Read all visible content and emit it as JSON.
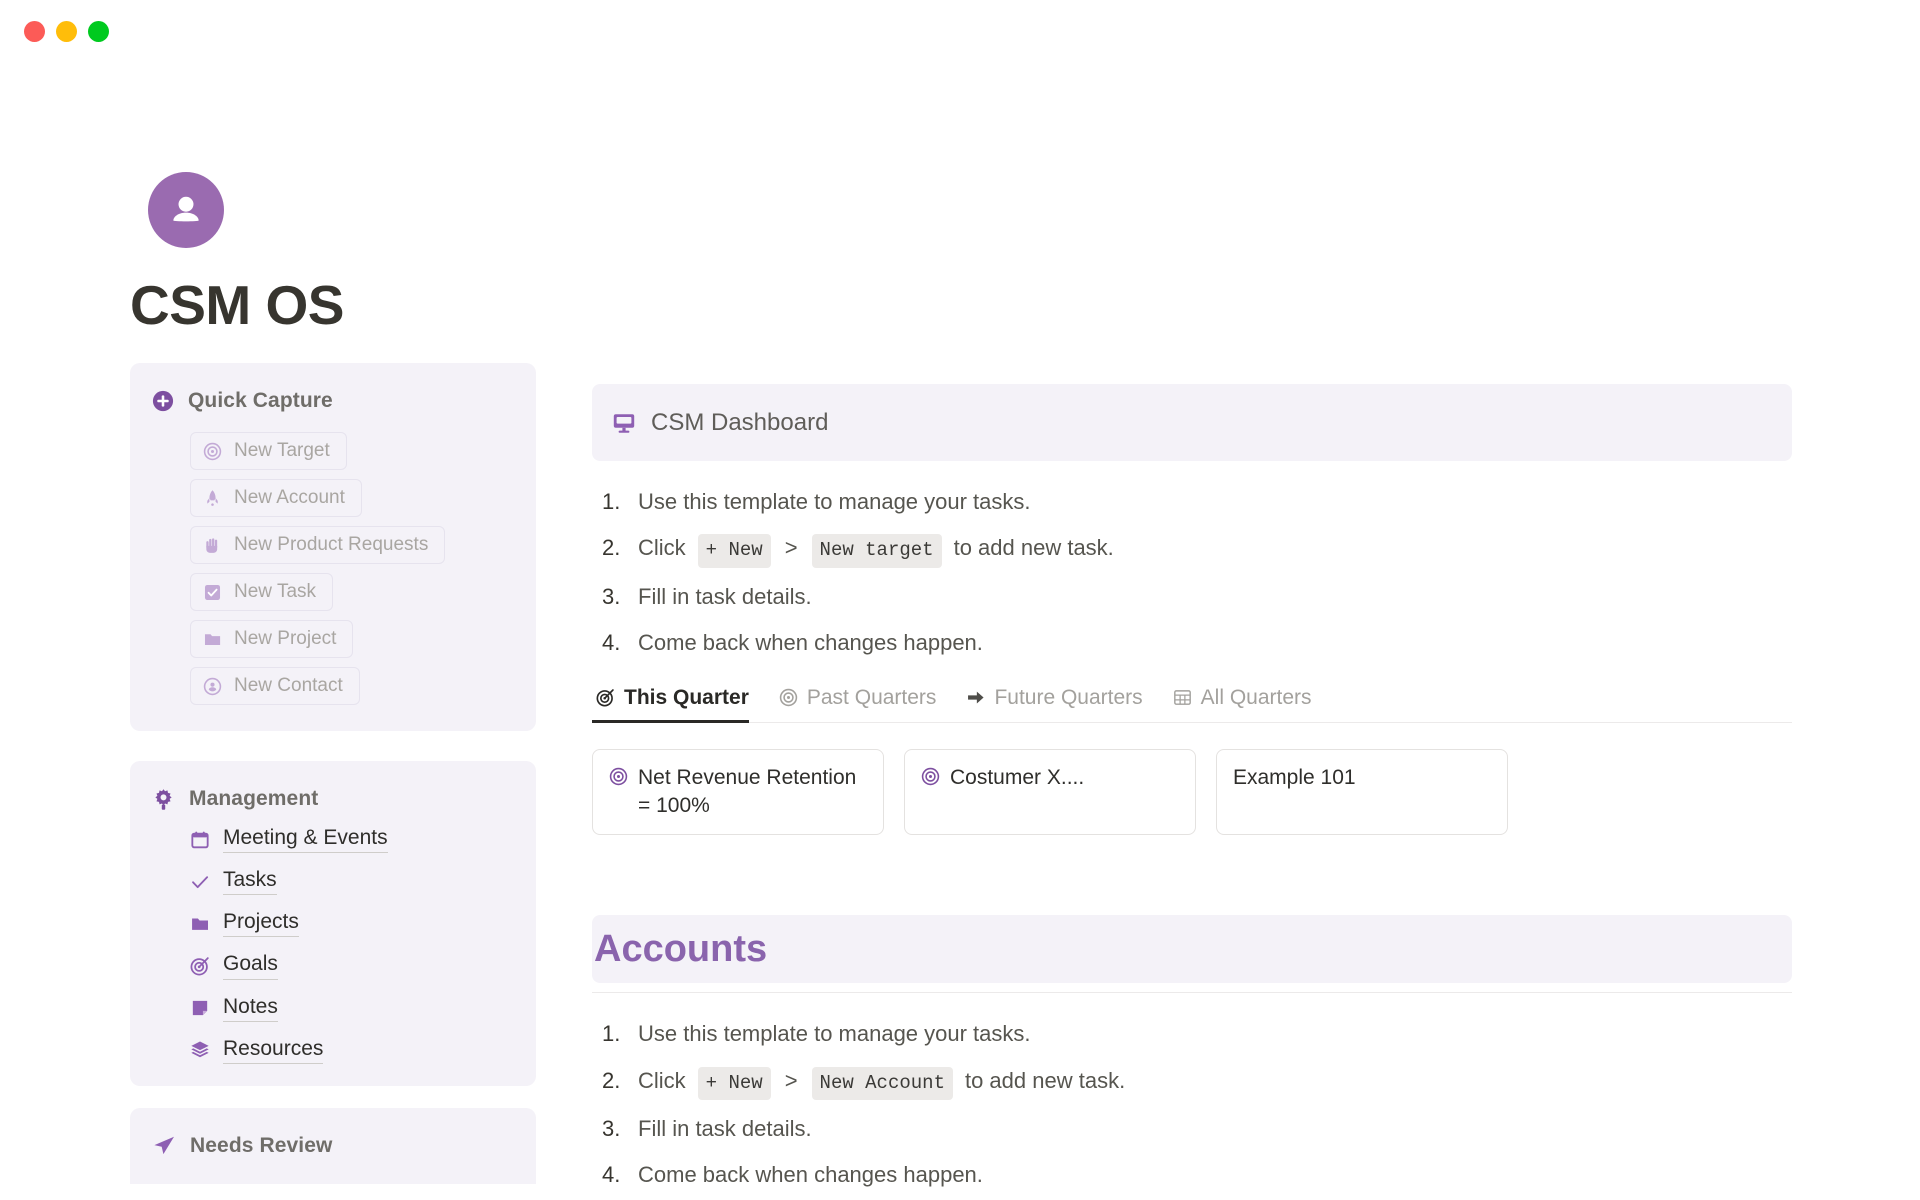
{
  "window": {
    "traffic_lights": [
      {
        "name": "close",
        "color": "#fc5b57"
      },
      {
        "name": "minimize",
        "color": "#ffbd0a"
      },
      {
        "name": "zoom",
        "color": "#00ca1f"
      }
    ]
  },
  "brand": {
    "title": "CSM OS",
    "avatar_icon": "user-avatar-icon",
    "avatar_color": "#9a6bb0"
  },
  "sidebar": {
    "quick_capture": {
      "title": "Quick Capture",
      "icon": "plus-circle-icon",
      "items": [
        {
          "label": "New Target",
          "icon": "target-icon"
        },
        {
          "label": "New Account",
          "icon": "rocket-icon"
        },
        {
          "label": "New Product Requests",
          "icon": "raised-hand-icon"
        },
        {
          "label": "New Task",
          "icon": "checkbox-icon"
        },
        {
          "label": "New Project",
          "icon": "folder-icon"
        },
        {
          "label": "New Contact",
          "icon": "contact-icon"
        }
      ]
    },
    "management": {
      "title": "Management",
      "icon": "gear-icon",
      "items": [
        {
          "label": "Meeting & Events",
          "icon": "calendar-icon"
        },
        {
          "label": "Tasks",
          "icon": "check-icon"
        },
        {
          "label": "Projects",
          "icon": "folder-icon"
        },
        {
          "label": "Goals",
          "icon": "goal-target-icon"
        },
        {
          "label": "Notes",
          "icon": "note-icon"
        },
        {
          "label": "Resources",
          "icon": "layers-icon"
        }
      ]
    },
    "needs_review": {
      "title": "Needs Review",
      "icon": "paper-plane-icon"
    }
  },
  "main": {
    "dashboard": {
      "title": "CSM Dashboard",
      "icon": "monitor-icon",
      "steps": [
        {
          "num": "1.",
          "pre": "Use this template to manage your tasks.",
          "code1": "",
          "gt": "",
          "code2": "",
          "post": ""
        },
        {
          "num": "2.",
          "pre": "Click",
          "code1": "+ New",
          "gt": ">",
          "code2": "New target",
          "post": "to add new task."
        },
        {
          "num": "3.",
          "pre": "Fill in task details.",
          "code1": "",
          "gt": "",
          "code2": "",
          "post": ""
        },
        {
          "num": "4.",
          "pre": "Come back when changes happen.",
          "code1": "",
          "gt": "",
          "code2": "",
          "post": ""
        }
      ],
      "tabs": [
        {
          "label": "This Quarter",
          "icon": "goal-target-icon",
          "active": true
        },
        {
          "label": "Past Quarters",
          "icon": "target-icon",
          "active": false
        },
        {
          "label": "Future Quarters",
          "icon": "arrow-right-icon",
          "active": false
        },
        {
          "label": "All Quarters",
          "icon": "table-icon",
          "active": false
        }
      ],
      "cards": [
        {
          "text": "Net Revenue Retention = 100%",
          "icon": "target-icon",
          "has_icon": true
        },
        {
          "text": "Costumer X....",
          "icon": "target-icon",
          "has_icon": true
        },
        {
          "text": "Example 101",
          "icon": "",
          "has_icon": false
        }
      ]
    },
    "accounts": {
      "title": "Accounts",
      "steps": [
        {
          "num": "1.",
          "pre": "Use this template to manage your tasks.",
          "code1": "",
          "gt": "",
          "code2": "",
          "post": ""
        },
        {
          "num": "2.",
          "pre": "Click",
          "code1": "+ New",
          "gt": ">",
          "code2": "New Account",
          "post": "to add new task."
        },
        {
          "num": "3.",
          "pre": "Fill in task details.",
          "code1": "",
          "gt": "",
          "code2": "",
          "post": ""
        },
        {
          "num": "4.",
          "pre": "Come back when changes happen.",
          "code1": "",
          "gt": "",
          "code2": "",
          "post": ""
        }
      ]
    }
  },
  "colors": {
    "accent_purple": "#8a64ad",
    "icon_purple": "#7d4fa0",
    "panel_bg": "#f4f2f8",
    "muted_text": "#a9a6a2"
  }
}
